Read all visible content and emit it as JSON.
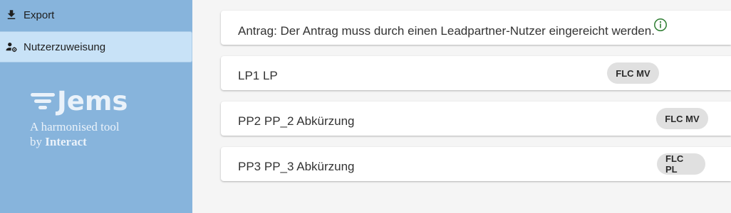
{
  "sidebar": {
    "items": [
      {
        "label": "Export",
        "icon": "download-icon"
      },
      {
        "label": "Nutzerzuweisung",
        "icon": "user-settings-icon",
        "active": true
      }
    ],
    "brand": {
      "name": "Jems",
      "tagline_line1": "A harmonised tool",
      "tagline_by": "by",
      "tagline_org": "Interact"
    }
  },
  "main": {
    "notice": {
      "text": "Antrag: Der Antrag muss durch einen Leadpartner-Nutzer eingereicht werden.",
      "icon": "info-icon"
    },
    "partners": [
      {
        "label": "LP1 LP",
        "chip": "FLC MV"
      },
      {
        "label": "PP2 PP_2 Abkürzung",
        "chip": "FLC MV"
      },
      {
        "label": "PP3 PP_3 Abkürzung",
        "chip": "FLC PL"
      }
    ]
  },
  "colors": {
    "sidebar_bg": "#87b4dc",
    "active_item_bg": "#c8e2f7",
    "info_icon": "#2e7d32",
    "chip_bg": "#e0e0e0"
  }
}
